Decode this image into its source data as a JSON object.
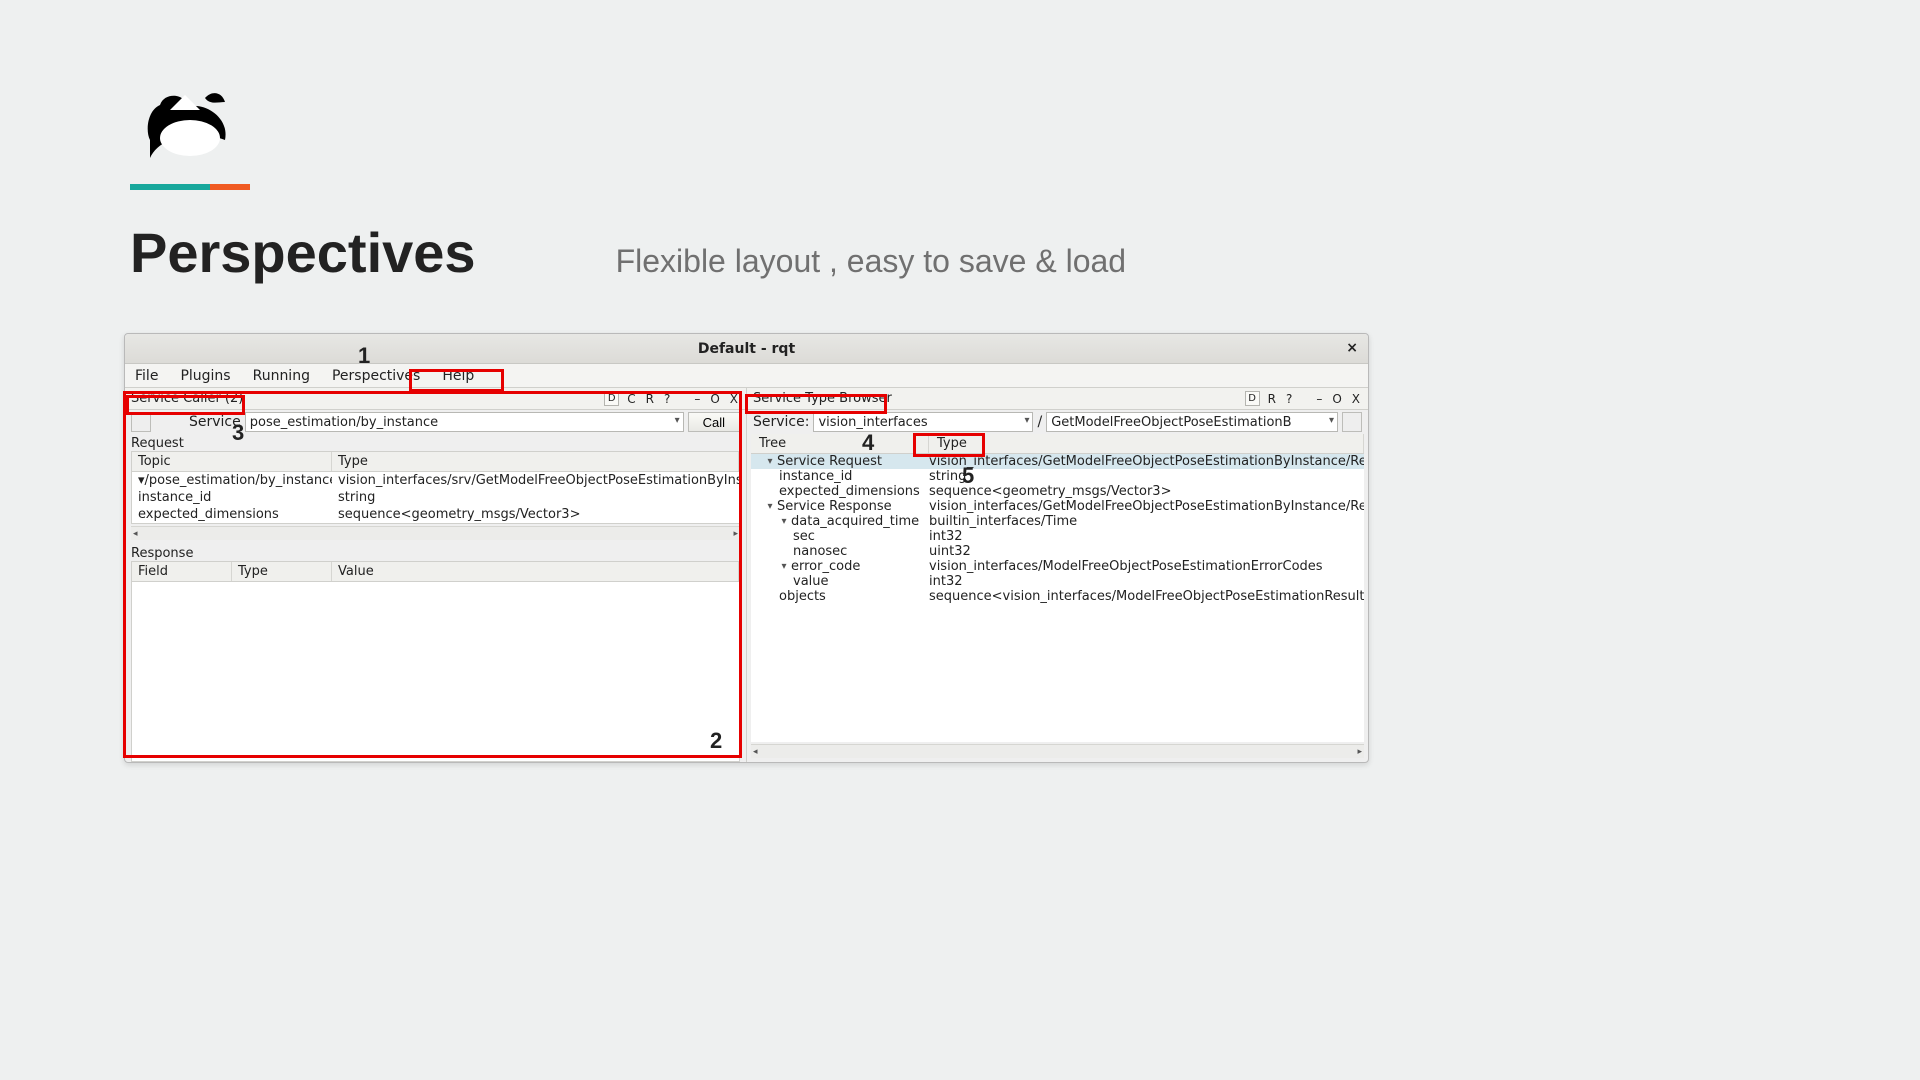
{
  "slide": {
    "title": "Perspectives",
    "subtitle": "Flexible layout , easy to save & load"
  },
  "window": {
    "title": "Default - rqt",
    "close_label": "×",
    "menubar": [
      "File",
      "Plugins",
      "Running",
      "Perspectives",
      "Help"
    ]
  },
  "service_caller": {
    "panel_title": "Service Caller (2)",
    "header_btns": {
      "d": "D",
      "c": "C",
      "r": "R",
      "q": "?",
      "dash": "–",
      "o": "O",
      "x": "X"
    },
    "service_label": "Service",
    "service_value": "pose_estimation/by_instance",
    "call_label": "Call",
    "request_label": "Request",
    "request_headers": {
      "topic": "Topic",
      "type": "Type"
    },
    "request_rows": [
      {
        "topic": "/pose_estimation/by_instance",
        "type": "vision_interfaces/srv/GetModelFreeObjectPoseEstimationByInsta",
        "twisty": "▾"
      },
      {
        "topic": "instance_id",
        "type": "string"
      },
      {
        "topic": "expected_dimensions",
        "type": "sequence<geometry_msgs/Vector3>"
      }
    ],
    "response_label": "Response",
    "response_headers": {
      "field": "Field",
      "type": "Type",
      "value": "Value"
    }
  },
  "type_browser": {
    "panel_title": "Service Type Browser",
    "header_btns": {
      "d": "D",
      "r": "R",
      "q": "?",
      "dash": "–",
      "o": "O",
      "x": "X"
    },
    "service_label": "Service:",
    "pkg": "vision_interfaces",
    "slash": "/",
    "srv": "GetModelFreeObjectPoseEstimationB",
    "tree_label": "Tree",
    "type_label": "Type",
    "rows": [
      {
        "name": "Service Request",
        "type": "vision_interfaces/GetModelFreeObjectPoseEstimationByInstance/Request",
        "ind": 0,
        "twisty": "▾",
        "sel": true
      },
      {
        "name": "instance_id",
        "type": "string",
        "ind": 1
      },
      {
        "name": "expected_dimensions",
        "type": "sequence<geometry_msgs/Vector3>",
        "ind": 1
      },
      {
        "name": "Service Response",
        "type": "vision_interfaces/GetModelFreeObjectPoseEstimationByInstance/Respons",
        "ind": 0,
        "twisty": "▾"
      },
      {
        "name": "data_acquired_time",
        "type": "builtin_interfaces/Time",
        "ind": 1,
        "twisty": "▾"
      },
      {
        "name": "sec",
        "type": "int32",
        "ind": 2
      },
      {
        "name": "nanosec",
        "type": "uint32",
        "ind": 2
      },
      {
        "name": "error_code",
        "type": "vision_interfaces/ModelFreeObjectPoseEstimationErrorCodes",
        "ind": 1,
        "twisty": "▾"
      },
      {
        "name": "value",
        "type": "int32",
        "ind": 2
      },
      {
        "name": "objects",
        "type": "sequence<vision_interfaces/ModelFreeObjectPoseEstimationResult>",
        "ind": 1
      }
    ]
  },
  "annotations": {
    "n1": "1",
    "n2": "2",
    "n3": "3",
    "n4": "4",
    "n5": "5"
  }
}
